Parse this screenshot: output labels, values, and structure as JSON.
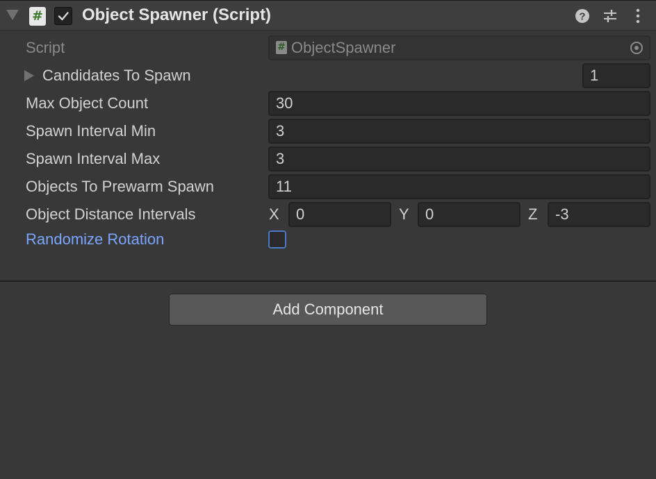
{
  "component": {
    "title": "Object Spawner (Script)",
    "enabled": true,
    "icon": "script-icon",
    "header_icons": [
      "help-icon",
      "presets-icon",
      "menu-icon"
    ]
  },
  "script": {
    "label": "Script",
    "value": "ObjectSpawner"
  },
  "candidates": {
    "label": "Candidates To Spawn",
    "count": "1"
  },
  "max_object_count": {
    "label": "Max Object Count",
    "value": "30"
  },
  "spawn_interval_min": {
    "label": "Spawn Interval Min",
    "value": "3"
  },
  "spawn_interval_max": {
    "label": "Spawn Interval Max",
    "value": "3"
  },
  "objects_to_prewarm": {
    "label": "Objects To Prewarm Spawn",
    "value": "11"
  },
  "distance_intervals": {
    "label": "Object Distance Intervals",
    "x_label": "X",
    "x": "0",
    "y_label": "Y",
    "y": "0",
    "z_label": "Z",
    "z": "-3"
  },
  "randomize_rotation": {
    "label": "Randomize Rotation",
    "checked": false
  },
  "add_component_label": "Add Component",
  "colors": {
    "background": "#383838",
    "field": "#2a2a2a",
    "modified_label": "#7ba6ff",
    "toggle_border": "#4c7ac6"
  }
}
